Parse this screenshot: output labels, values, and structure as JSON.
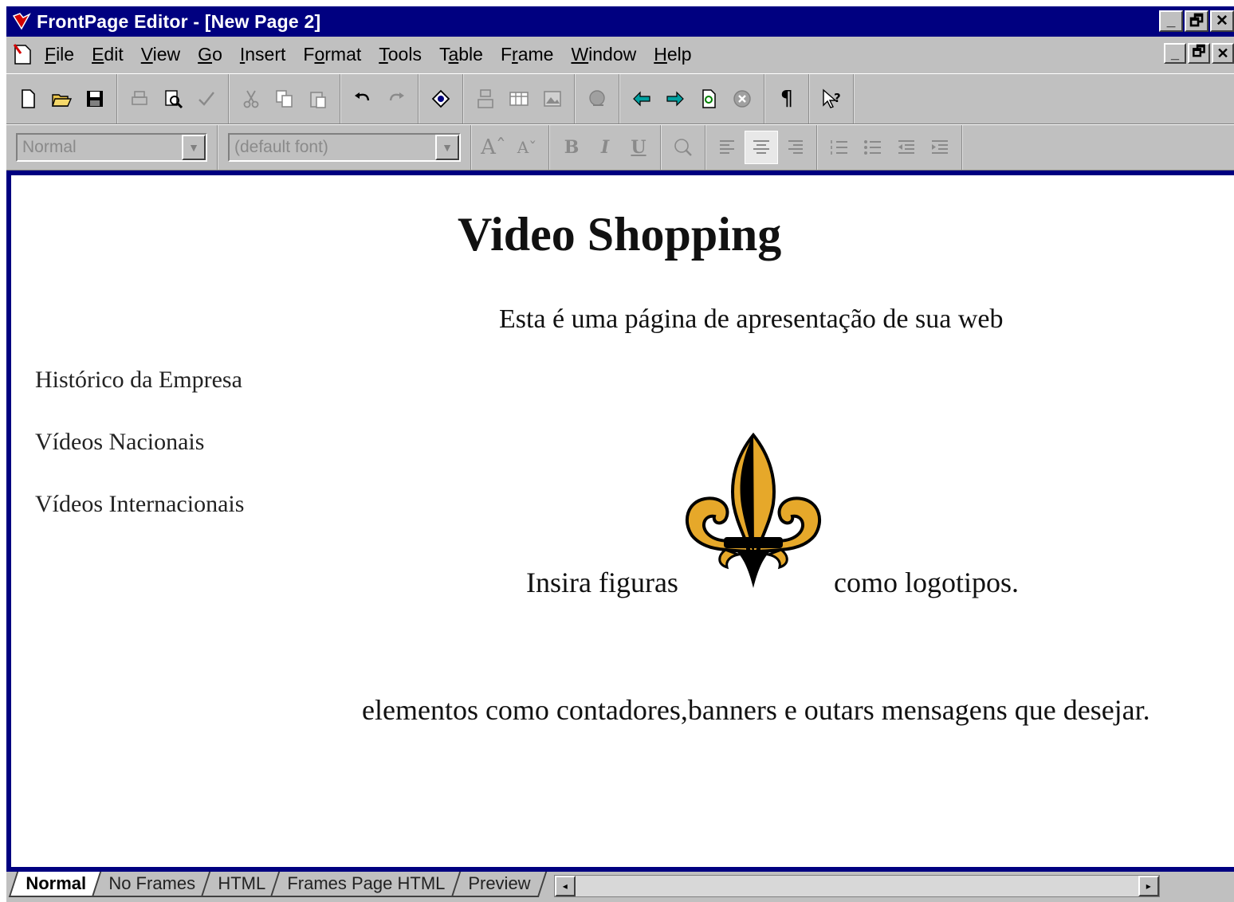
{
  "window": {
    "title": "FrontPage Editor - [New Page 2]",
    "minimize_glyph": "_",
    "restore_glyph": "🗗",
    "close_glyph": "✕"
  },
  "menu": [
    {
      "pre": "",
      "u": "F",
      "post": "ile"
    },
    {
      "pre": "",
      "u": "E",
      "post": "dit"
    },
    {
      "pre": "",
      "u": "V",
      "post": "iew"
    },
    {
      "pre": "",
      "u": "G",
      "post": "o"
    },
    {
      "pre": "",
      "u": "I",
      "post": "nsert"
    },
    {
      "pre": "F",
      "u": "o",
      "post": "rmat"
    },
    {
      "pre": "",
      "u": "T",
      "post": "ools"
    },
    {
      "pre": "T",
      "u": "a",
      "post": "ble"
    },
    {
      "pre": "F",
      "u": "r",
      "post": "ame"
    },
    {
      "pre": "",
      "u": "W",
      "post": "indow"
    },
    {
      "pre": "",
      "u": "H",
      "post": "elp"
    }
  ],
  "format_toolbar": {
    "style_value": "Normal",
    "font_value": "(default font)",
    "bold": "B",
    "italic": "I",
    "underline": "U"
  },
  "page": {
    "title": "Video Shopping",
    "subtitle": "Esta é uma página de apresentação de sua web",
    "links": [
      "Histórico da Empresa",
      "Vídeos Nacionais",
      "Vídeos Internacionais"
    ],
    "insert_text": "Insira figuras",
    "logo_text": "como logotipos.",
    "bottom_text": "elementos como contadores,banners e outars mensagens que desejar.",
    "logo_icon": "fleur-de-lis-icon",
    "logo_colors": {
      "gold": "#e6a82a",
      "black": "#000000"
    }
  },
  "tabs": [
    "Normal",
    "No Frames",
    "HTML",
    "Frames Page HTML",
    "Preview"
  ],
  "colors": {
    "titlebar": "#000080",
    "chrome": "#c0c0c0"
  }
}
